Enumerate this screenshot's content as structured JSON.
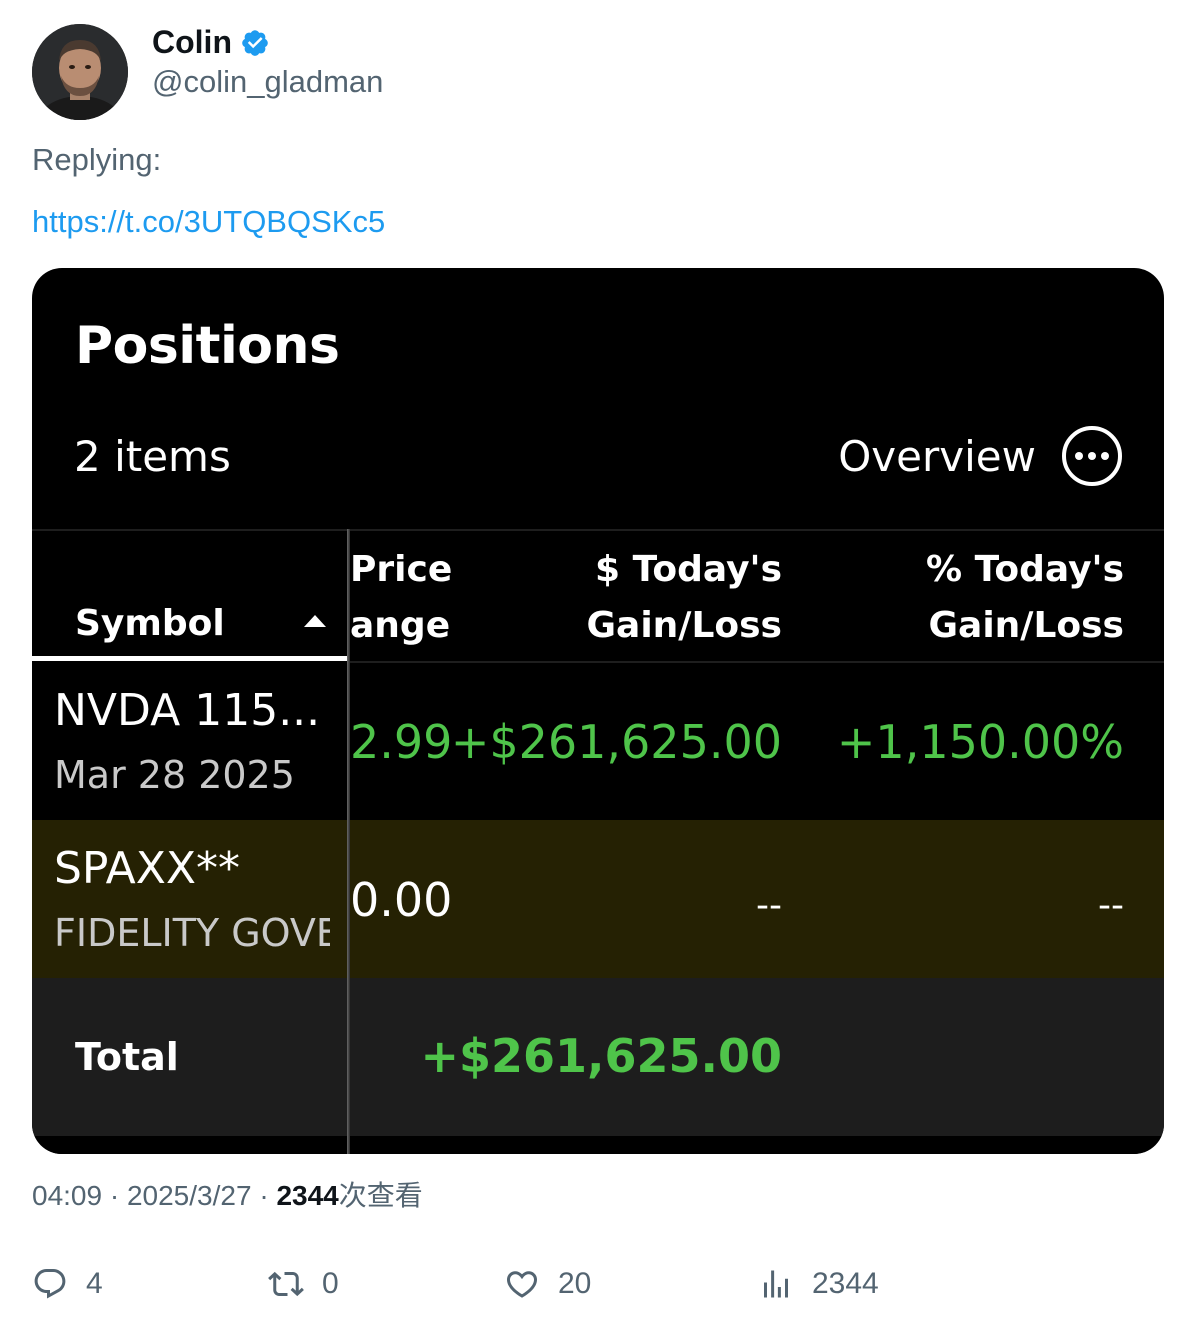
{
  "author": {
    "display_name": "Colin",
    "handle": "@colin_gladman",
    "verified": true,
    "verified_color": "#1d9bf0"
  },
  "tweet": {
    "replying_label": "Replying:",
    "link": "https://t.co/3UTQBQSKc5",
    "time": "04:09",
    "date": "2025/3/27",
    "views_count": "2344",
    "views_label": "次查看"
  },
  "screenshot": {
    "title": "Positions",
    "items_count": "2 items",
    "overview_label": "Overview",
    "columns": {
      "symbol": "Symbol",
      "price_line1": "Price",
      "price_line2": "ange",
      "dollar_line1": "$ Today's",
      "dollar_line2": "Gain/Loss",
      "pct_line1": "% Today's",
      "pct_line2": "Gain/Loss"
    },
    "rows": [
      {
        "symbol": "NVDA 115...",
        "subtitle": "Mar 28 2025",
        "price_change": "2.99",
        "dollar_gain": "+$261,625.00",
        "pct_gain": "+1,150.00%"
      },
      {
        "symbol": "SPAXX**",
        "subtitle": "FIDELITY GOVE",
        "price_change": "0.00",
        "dollar_gain": "--",
        "pct_gain": "--"
      }
    ],
    "total": {
      "label": "Total",
      "dollar_gain": "+$261,625.00"
    },
    "colors": {
      "gain_green": "#4fc44a",
      "highlight_row": "#252103",
      "total_row": "#1d1d1d"
    }
  },
  "actions": {
    "replies": "4",
    "retweets": "0",
    "likes": "20",
    "views": "2344"
  }
}
